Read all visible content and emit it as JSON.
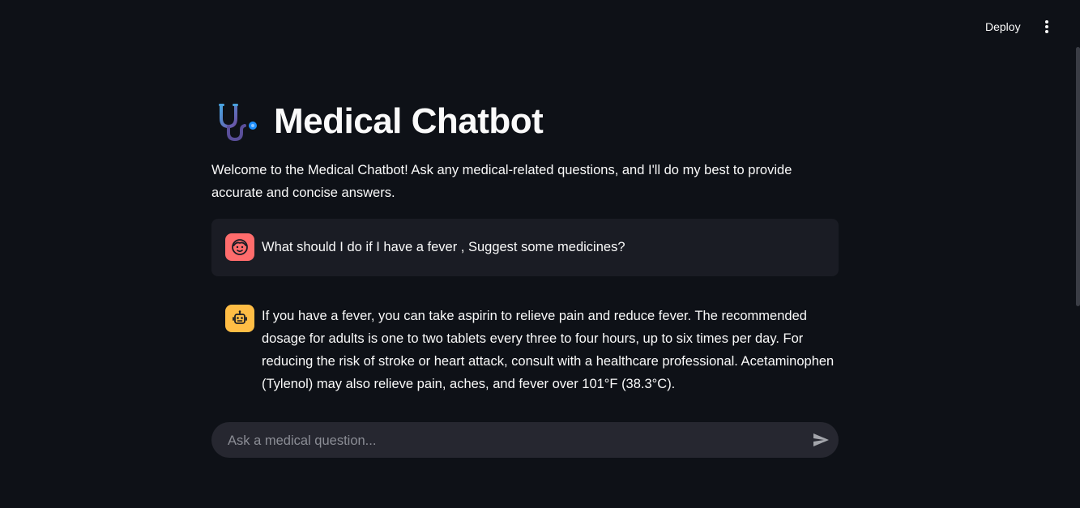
{
  "header": {
    "deploy_label": "Deploy",
    "menu_icon": "vertical-ellipsis-icon"
  },
  "page": {
    "title_icon": "stethoscope-icon",
    "title": "Medical Chatbot",
    "welcome": "Welcome to the Medical Chatbot! Ask any medical-related questions, and I'll do my best to provide accurate and concise answers."
  },
  "messages": [
    {
      "role": "user",
      "avatar_icon": "user-face-icon",
      "avatar_color": "#ff6c6c",
      "text": "What should I do if I have a fever , Suggest some medicines?"
    },
    {
      "role": "assistant",
      "avatar_icon": "robot-icon",
      "avatar_color": "#ffbd45",
      "text": "If you have a fever, you can take aspirin to relieve pain and reduce fever. The recommended dosage for adults is one to two tablets every three to four hours, up to six times per day. For reducing the risk of stroke or heart attack, consult with a healthcare professional. Acetaminophen (Tylenol) may also relieve pain, aches, and fever over 101°F (38.3°C)."
    }
  ],
  "chat_input": {
    "placeholder": "Ask a medical question...",
    "value": "",
    "send_icon": "send-icon"
  },
  "colors": {
    "background": "#0e1117",
    "user_bubble": "#1a1c24",
    "input_bg": "#262730"
  }
}
